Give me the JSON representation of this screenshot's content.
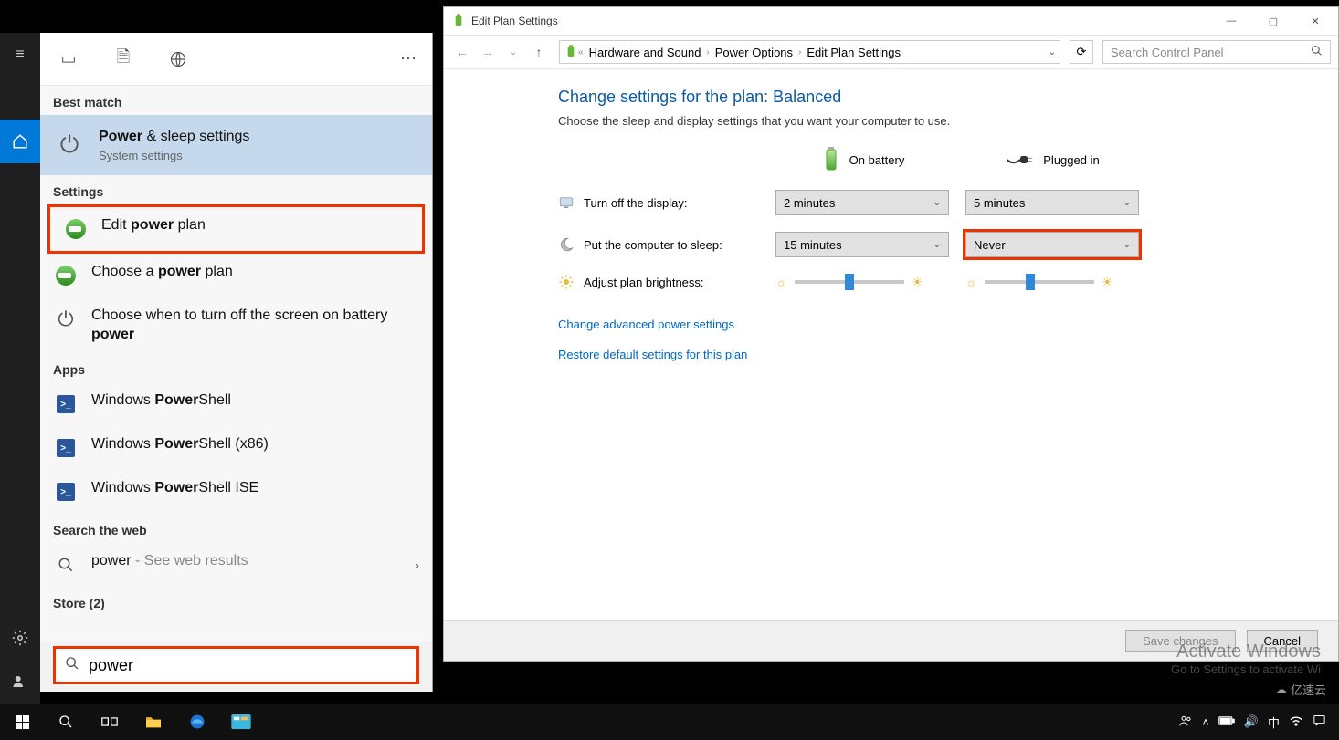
{
  "window": {
    "title": "Edit Plan Settings"
  },
  "breadcrumb": {
    "p1": "Hardware and Sound",
    "p2": "Power Options",
    "p3": "Edit Plan Settings"
  },
  "searchcp": {
    "placeholder": "Search Control Panel"
  },
  "cp": {
    "title": "Change settings for the plan: Balanced",
    "sub": "Choose the sleep and display settings that you want your computer to use.",
    "col_battery": "On battery",
    "col_plugged": "Plugged in",
    "row_display": "Turn off the display:",
    "row_sleep": "Put the computer to sleep:",
    "row_bright": "Adjust plan brightness:",
    "display_batt": "2 minutes",
    "display_plug": "5 minutes",
    "sleep_batt": "15 minutes",
    "sleep_plug": "Never",
    "link_adv": "Change advanced power settings",
    "link_restore": "Restore default settings for this plan",
    "save": "Save changes",
    "cancel": "Cancel"
  },
  "watermark": {
    "l1": "Activate Windows",
    "l2": "Go to Settings to activate Wi"
  },
  "search_panel": {
    "best_match": "Best match",
    "best_title_pre": "Power",
    "best_title_post": " & sleep settings",
    "best_sub": "System settings",
    "settings_h": "Settings",
    "s1_pre": "Edit ",
    "s1_bold": "power",
    "s1_post": " plan",
    "s2_pre": "Choose a ",
    "s2_bold": "power",
    "s2_post": " plan",
    "s3_pre": "Choose when to turn off the screen on battery ",
    "s3_bold": "power",
    "apps_h": "Apps",
    "a1_pre": "Windows ",
    "a1_bold": "Power",
    "a1_post": "Shell",
    "a2_pre": "Windows ",
    "a2_bold": "Power",
    "a2_post": "Shell (x86)",
    "a3_pre": "Windows ",
    "a3_bold": "Power",
    "a3_post": "Shell ISE",
    "web_h": "Search the web",
    "web_q": "power",
    "web_suffix": " - See web results",
    "store_h": "Store (2)",
    "input": "power"
  },
  "brand": "亿速云"
}
